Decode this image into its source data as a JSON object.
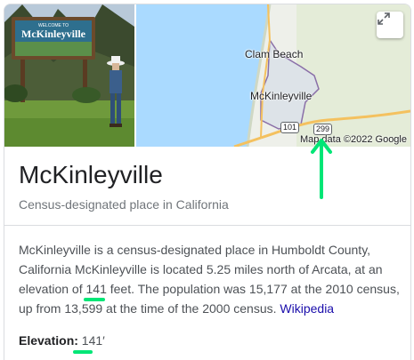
{
  "place": {
    "title": "McKinleyville",
    "subtitle": "Census-designated place in California"
  },
  "photo": {
    "sign_welcome": "WELCOME TO",
    "sign_name": "McKinleyville"
  },
  "map": {
    "labels": [
      "Clam Beach",
      "McKinleyville"
    ],
    "route_shields": [
      "101",
      "299"
    ],
    "credit": "Map data ©2022 Google",
    "expand_icon": "expand-icon"
  },
  "description": {
    "text_1": "McKinleyville is a census-designated place in Humboldt County, California McKinleyville is located 5.25 miles north of Arcata, at an elevation of ",
    "elev_value": "141",
    "text_2": " feet. The population was 15,177 at the 2010 census, up from 13,599 at the time of the 2000 census. ",
    "source_link": "Wikipedia"
  },
  "facts": {
    "elevation_label": "Elevation:",
    "elevation_value": "141′"
  },
  "colors": {
    "annotation": "#00e676",
    "link": "#1a0dab"
  }
}
